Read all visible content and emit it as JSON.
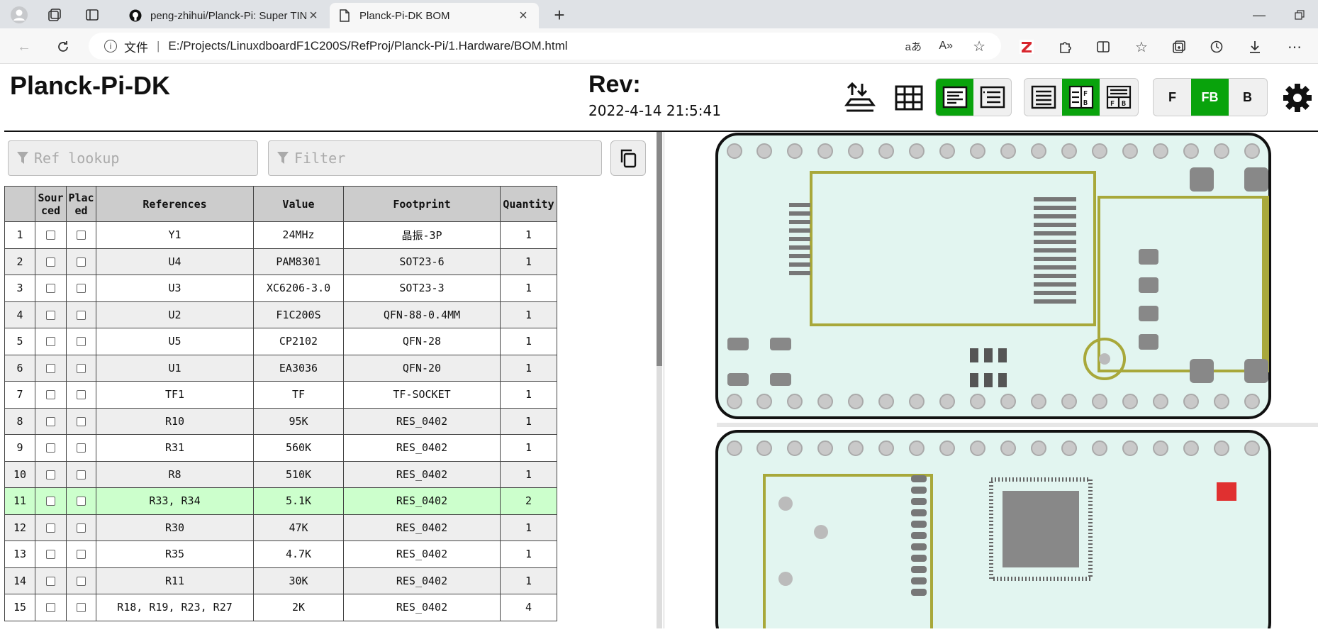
{
  "browser": {
    "tabs": [
      {
        "label": "peng-zhihui/Planck-Pi: Super TIN",
        "icon": "github-icon"
      },
      {
        "label": "Planck-Pi-DK BOM",
        "icon": "document-icon"
      }
    ],
    "url_prefix": "文件",
    "url": "E:/Projects/LinuxdboardF1C200S/RefProj/Planck-Pi/1.Hardware/BOM.html"
  },
  "header": {
    "title": "Planck-Pi-DK",
    "rev_label": "Rev:",
    "date": "2022-4-14 21:5:41",
    "layer_buttons": [
      "F",
      "FB",
      "B"
    ],
    "active_layer": "FB",
    "accent_color": "#09a30c"
  },
  "search": {
    "ref_placeholder": "Ref lookup",
    "filter_placeholder": "Filter"
  },
  "bom": {
    "columns": [
      "",
      "Sourced",
      "Placed",
      "References",
      "Value",
      "Footprint",
      "Quantity"
    ],
    "sourced_header": [
      "Sour",
      "ced"
    ],
    "placed_header": [
      "Plac",
      "ed"
    ],
    "rows": [
      {
        "n": "1",
        "refs": "Y1",
        "value": "24MHz",
        "footprint": "晶振-3P",
        "qty": "1"
      },
      {
        "n": "2",
        "refs": "U4",
        "value": "PAM8301",
        "footprint": "SOT23-6",
        "qty": "1"
      },
      {
        "n": "3",
        "refs": "U3",
        "value": "XC6206-3.0",
        "footprint": "SOT23-3",
        "qty": "1"
      },
      {
        "n": "4",
        "refs": "U2",
        "value": "F1C200S",
        "footprint": "QFN-88-0.4MM",
        "qty": "1"
      },
      {
        "n": "5",
        "refs": "U5",
        "value": "CP2102",
        "footprint": "QFN-28",
        "qty": "1"
      },
      {
        "n": "6",
        "refs": "U1",
        "value": "EA3036",
        "footprint": "QFN-20",
        "qty": "1"
      },
      {
        "n": "7",
        "refs": "TF1",
        "value": "TF",
        "footprint": "TF-SOCKET",
        "qty": "1"
      },
      {
        "n": "8",
        "refs": "R10",
        "value": "95K",
        "footprint": "RES_0402",
        "qty": "1"
      },
      {
        "n": "9",
        "refs": "R31",
        "value": "560K",
        "footprint": "RES_0402",
        "qty": "1"
      },
      {
        "n": "10",
        "refs": "R8",
        "value": "510K",
        "footprint": "RES_0402",
        "qty": "1"
      },
      {
        "n": "11",
        "refs": "R33, R34",
        "value": "5.1K",
        "footprint": "RES_0402",
        "qty": "2"
      },
      {
        "n": "12",
        "refs": "R30",
        "value": "47K",
        "footprint": "RES_0402",
        "qty": "1"
      },
      {
        "n": "13",
        "refs": "R35",
        "value": "4.7K",
        "footprint": "RES_0402",
        "qty": "1"
      },
      {
        "n": "14",
        "refs": "R11",
        "value": "30K",
        "footprint": "RES_0402",
        "qty": "1"
      },
      {
        "n": "15",
        "refs": "R18, R19, R23, R27",
        "value": "2K",
        "footprint": "RES_0402",
        "qty": "4"
      }
    ],
    "highlighted_row": "11"
  }
}
